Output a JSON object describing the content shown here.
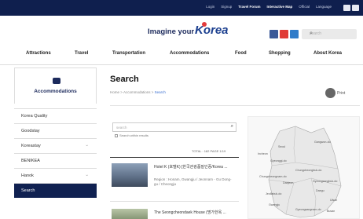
{
  "topbar": {
    "links": [
      "Login",
      "Signup",
      "Travel Forum",
      "Interactive Map",
      "Official",
      "Language"
    ],
    "icons": [
      "share-icon",
      "menu-icon"
    ]
  },
  "header": {
    "tagline": "Imagine your",
    "logo_text": "Korea",
    "sns": [
      "facebook-icon",
      "blog-icon",
      "twitter-icon"
    ],
    "search_placeholder": "search"
  },
  "nav": {
    "items": [
      "Attractions",
      "Travel",
      "Transportation",
      "Accommodations",
      "Food",
      "Shopping",
      "About Korea"
    ]
  },
  "sidebar": {
    "title": "Accommodations",
    "items": [
      {
        "label": "Korea Quality",
        "chevron": ""
      },
      {
        "label": "Goodstay",
        "chevron": ""
      },
      {
        "label": "Koreastay",
        "chevron": "⌄"
      },
      {
        "label": "BENIKEA",
        "chevron": ""
      },
      {
        "label": "Hanok",
        "chevron": "⌄"
      },
      {
        "label": "Search",
        "chevron": ""
      }
    ]
  },
  "main": {
    "title": "Search",
    "breadcrumb": {
      "home": "Home",
      "sep": ">",
      "section": "Accommodations",
      "current": "Search"
    },
    "print_label": "Print",
    "search_placeholder": "search",
    "within_label": "Search within results",
    "stats": "TOTAL : 182    PAGE 1/19",
    "results": [
      {
        "title": "Hotel K (호텔K) [한국관광품질인증/Korea ...",
        "address": "Region : Honam, Gwangju / Jeonnam - Gu Dong-gu / Cheongju"
      },
      {
        "title": "The Seongcheondaek House (명가한옥 ...",
        "address": ""
      }
    ]
  },
  "map": {
    "cities": [
      "Incheon",
      "Seoul",
      "Gangwon-do",
      "Gyeonggi-do",
      "Chungcheongbuk-do",
      "Chungcheongnam-do",
      "Daejeon",
      "Gyeongsangbuk-do",
      "Daegu",
      "Jeollabuk-do",
      "Ulsan",
      "Gwangju",
      "Gyeongsangnam-do",
      "Busan"
    ]
  },
  "colors": {
    "topbar": "#0f1f4e",
    "active": "#102151",
    "accent": "#3a6fd0"
  }
}
